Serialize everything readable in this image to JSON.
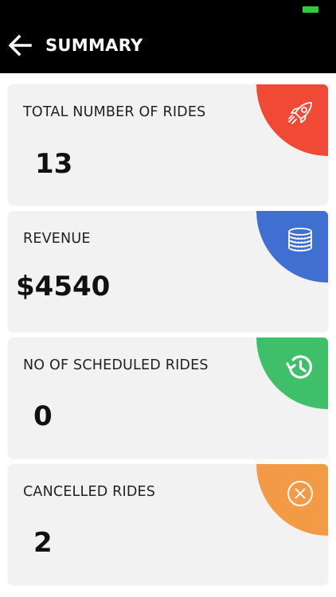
{
  "header": {
    "title": "SUMMARY"
  },
  "cards": [
    {
      "label": "TOTAL NUMBER OF RIDES",
      "value": "13",
      "color": "#f04a36",
      "icon": "rocket-icon"
    },
    {
      "label": "REVENUE",
      "value": "$4540",
      "color": "#3f6fd0",
      "icon": "coins-icon"
    },
    {
      "label": "NO OF SCHEDULED RIDES",
      "value": "0",
      "color": "#3fbf6a",
      "icon": "history-icon"
    },
    {
      "label": "CANCELLED RIDES",
      "value": "2",
      "color": "#f39a46",
      "icon": "cancel-circle-icon"
    }
  ]
}
